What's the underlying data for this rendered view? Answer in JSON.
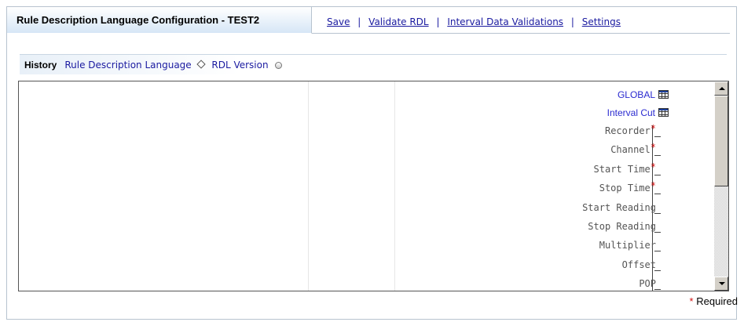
{
  "header": {
    "title": "Rule Description Language Configuration - TEST2",
    "actions": [
      "Save",
      "Validate RDL",
      "Interval Data Validations",
      "Settings"
    ],
    "separator": "|"
  },
  "subtabs": {
    "history": "History",
    "rdl": "Rule Description Language",
    "rdl_version": "RDL Version"
  },
  "tree": {
    "global": "GLOBAL",
    "interval_cut": "Interval Cut",
    "fields": [
      {
        "label": "Recorder",
        "required": true
      },
      {
        "label": "Channel",
        "required": true
      },
      {
        "label": "Start Time",
        "required": true
      },
      {
        "label": "Stop Time",
        "required": true
      },
      {
        "label": "Start Reading",
        "required": false
      },
      {
        "label": "Stop Reading",
        "required": false
      },
      {
        "label": "Multiplier",
        "required": false
      },
      {
        "label": "Offset",
        "required": false
      },
      {
        "label": "POP",
        "required": false
      }
    ],
    "required_marker": "*"
  },
  "footer": {
    "required_star": "*",
    "required_label": "Required"
  },
  "colors": {
    "link": "#1a1aa0",
    "required": "#d01010",
    "tab_gradient_end": "#d6e6f6"
  },
  "icons": {
    "grid": "table-grid-icon",
    "scroll_up": "scroll-up-arrow",
    "scroll_down": "scroll-down-arrow"
  }
}
